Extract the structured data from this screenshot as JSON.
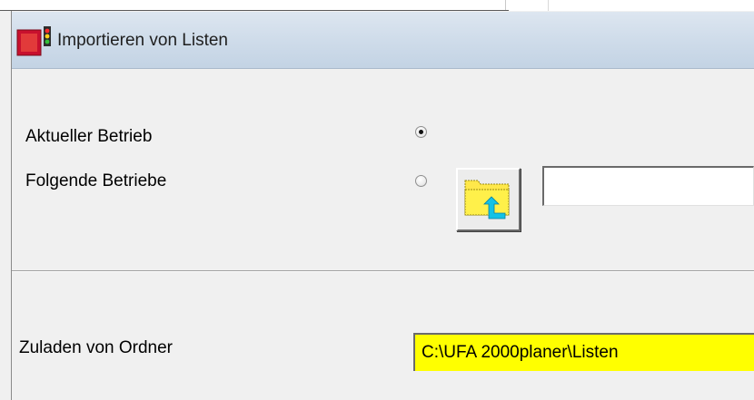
{
  "window": {
    "title": "Importieren von Listen",
    "icon": "app-icon"
  },
  "options": {
    "aktueller_betrieb": {
      "label": "Aktueller Betrieb",
      "selected": true
    },
    "folgende_betriebe": {
      "label": "Folgende Betriebe",
      "selected": false,
      "value": ""
    }
  },
  "folder_button": {
    "icon": "folder-upload-icon"
  },
  "ordner": {
    "label": "Zuladen von Ordner",
    "value": "C:\\UFA 2000planer\\Listen"
  },
  "colors": {
    "highlight_field": "#ffff00",
    "folder_yellow": "#ffe84a",
    "arrow_cyan": "#13c2e6"
  }
}
